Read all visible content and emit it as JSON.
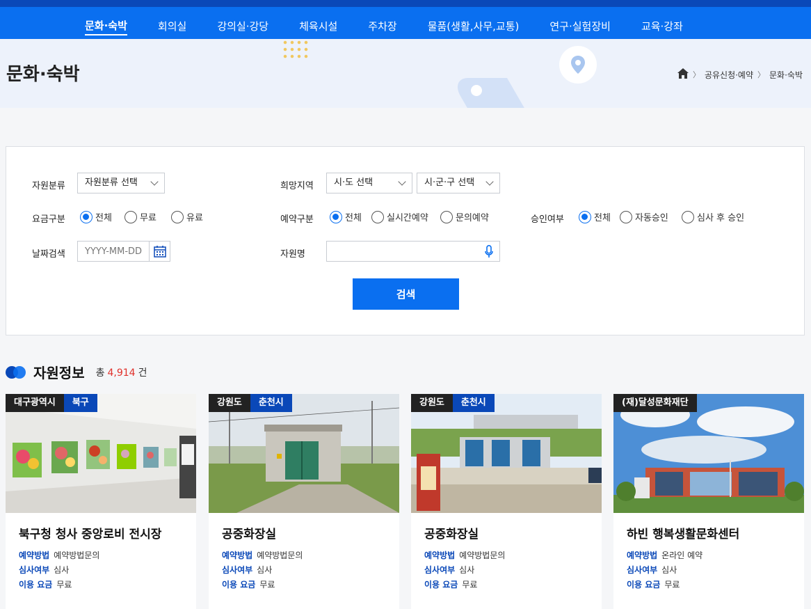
{
  "nav": {
    "items": [
      "문화·숙박",
      "회의실",
      "강의실·강당",
      "체육시설",
      "주차장",
      "물품(생활,사무,교통)",
      "연구·실험장비",
      "교육·강좌"
    ],
    "active_index": 0
  },
  "header": {
    "title": "문화·숙박",
    "breadcrumb": [
      "공유신청·예약",
      "문화·숙박"
    ]
  },
  "search": {
    "resource_type_label": "자원분류",
    "resource_type_value": "자원분류 선택",
    "region_label": "희망지역",
    "region_sido": "시·도 선택",
    "region_sigungu": "시·군·구 선택",
    "fee_label": "요금구분",
    "fee_options": [
      "전체",
      "무료",
      "유료"
    ],
    "reserve_label": "예약구분",
    "reserve_options": [
      "전체",
      "실시간예약",
      "문의예약"
    ],
    "approval_label": "승인여부",
    "approval_options": [
      "전체",
      "자동승인",
      "심사 후 승인"
    ],
    "date_label": "날짜검색",
    "date_placeholder": "YYYY-MM-DD",
    "name_label": "자원명",
    "name_value": "",
    "button": "검색"
  },
  "results": {
    "title": "자원정보",
    "count_prefix": "총",
    "count": "4,914",
    "count_suffix": "건"
  },
  "meta_labels": {
    "method": "예약방법",
    "review": "심사여부",
    "fee": "이용 요금"
  },
  "cards": [
    {
      "tags": [
        "대구광역시",
        "북구"
      ],
      "title": "북구청 청사 중앙로비 전시장",
      "method": "예약방법문의",
      "review": "심사",
      "fee": "무료"
    },
    {
      "tags": [
        "강원도",
        "춘천시"
      ],
      "title": "공중화장실",
      "method": "예약방법문의",
      "review": "심사",
      "fee": "무료"
    },
    {
      "tags": [
        "강원도",
        "춘천시"
      ],
      "title": "공중화장실",
      "method": "예약방법문의",
      "review": "심사",
      "fee": "무료"
    },
    {
      "tags": [
        "(재)달성문화재단"
      ],
      "title": "하빈 행복생활문화센터",
      "method": "온라인 예약",
      "review": "심사",
      "fee": "무료"
    }
  ],
  "colors": {
    "primary": "#0a6ff0",
    "navy": "#0a48b8",
    "count": "#e0302a"
  }
}
